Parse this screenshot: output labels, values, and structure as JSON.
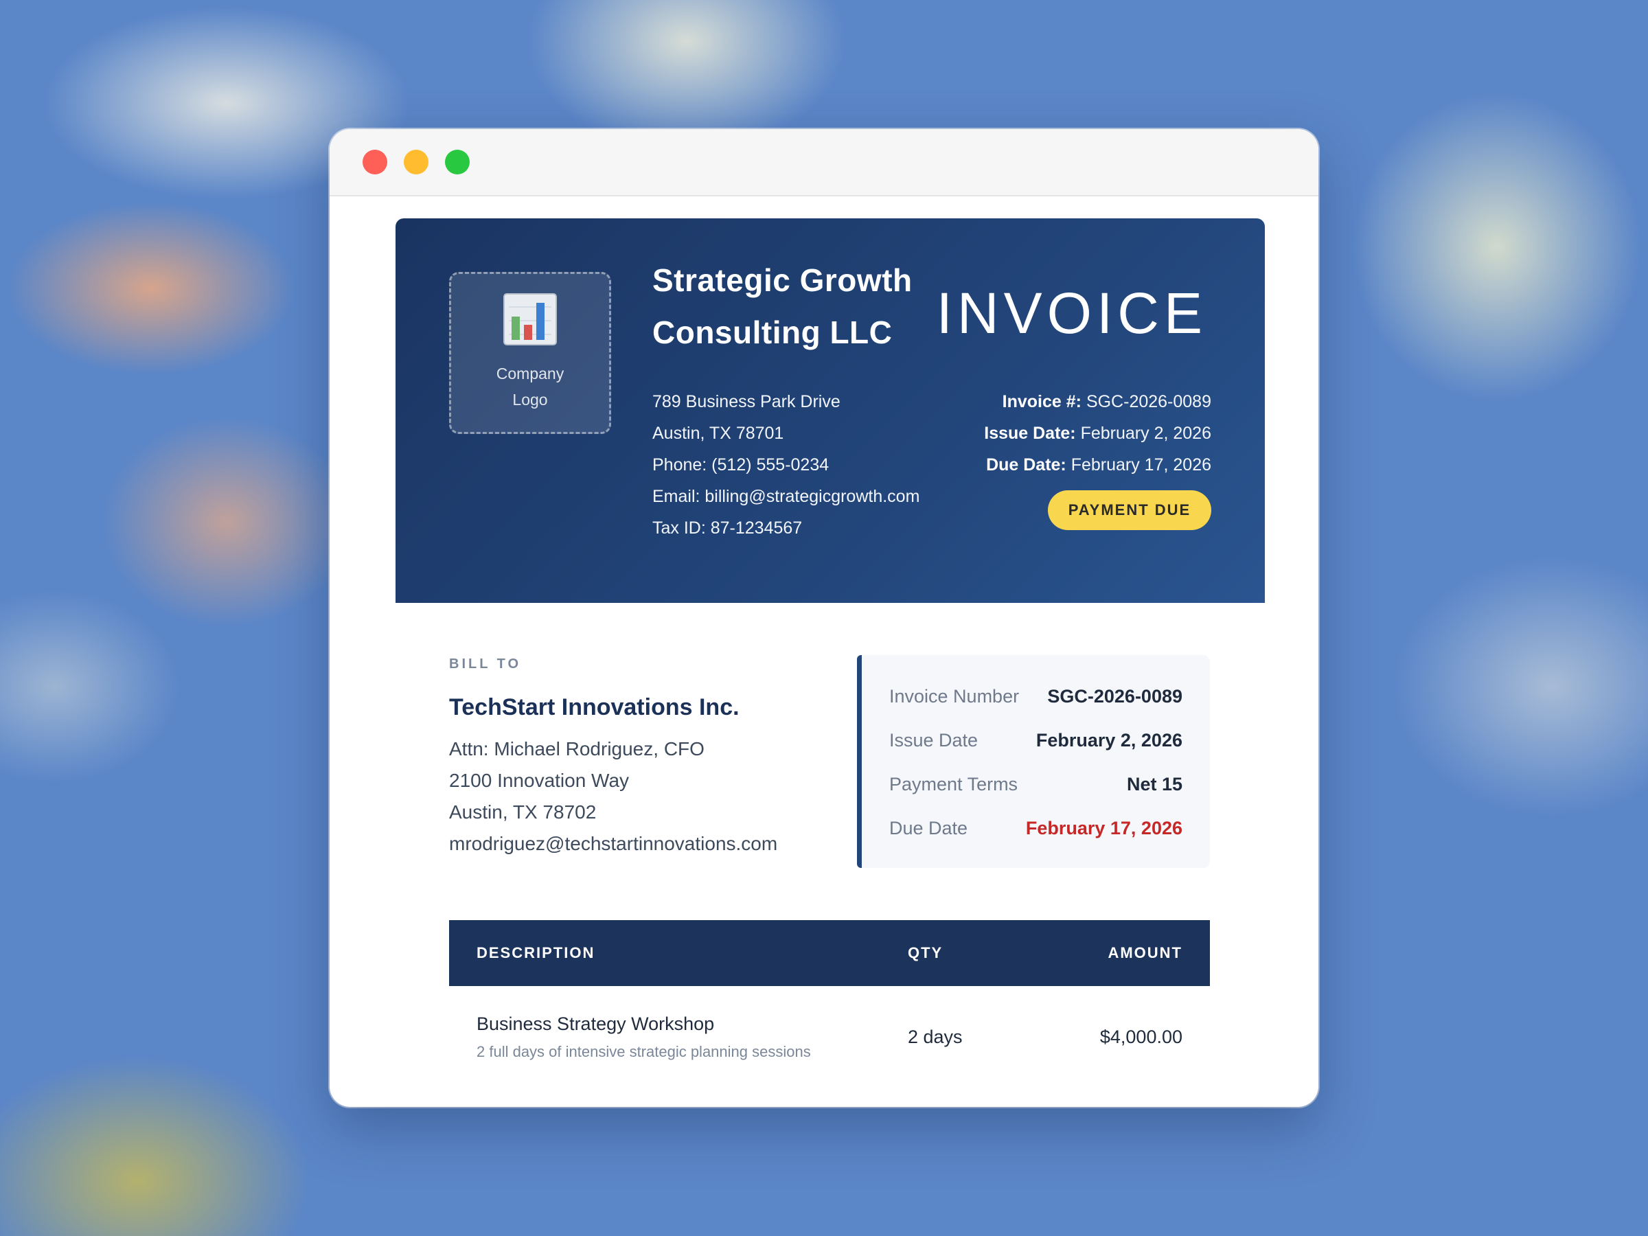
{
  "window": {
    "controls": {
      "close_color": "#fe5f57",
      "minimize_color": "#febc2e",
      "maximize_color": "#28c840"
    }
  },
  "company": {
    "logo_icon": "bar-chart-icon",
    "logo_label": "Company Logo",
    "name": "Strategic Growth Consulting LLC",
    "address_line1": "789 Business Park Drive",
    "address_line2": "Austin, TX 78701",
    "phone": "Phone: (512) 555-0234",
    "email": "Email: billing@strategicgrowth.com",
    "tax_id": "Tax ID: 87-1234567"
  },
  "invoice": {
    "title": "INVOICE",
    "number_label": "Invoice #:",
    "number": "SGC-2026-0089",
    "issue_label": "Issue Date:",
    "issue_date": "February 2, 2026",
    "due_label": "Due Date:",
    "due_date": "February 17, 2026",
    "status_badge": "PAYMENT DUE"
  },
  "bill_to": {
    "label": "BILL TO",
    "name": "TechStart Innovations Inc.",
    "attn": "Attn: Michael Rodriguez, CFO",
    "address_line1": "2100 Innovation Way",
    "address_line2": "Austin, TX 78702",
    "email": "mrodriguez@techstartinnovations.com"
  },
  "summary": [
    {
      "label": "Invoice Number",
      "value": "SGC-2026-0089"
    },
    {
      "label": "Issue Date",
      "value": "February 2, 2026"
    },
    {
      "label": "Payment Terms",
      "value": "Net 15"
    },
    {
      "label": "Due Date",
      "value": "February 17, 2026"
    }
  ],
  "items": {
    "headers": {
      "description": "DESCRIPTION",
      "qty": "QTY",
      "amount": "AMOUNT"
    },
    "rows": [
      {
        "title": "Business Strategy Workshop",
        "subtitle": "2 full days of intensive strategic planning sessions",
        "qty": "2 days",
        "amount": "$4,000.00"
      }
    ]
  },
  "colors": {
    "brand_navy": "#1c335c",
    "badge_yellow": "#f8d64e",
    "due_red": "#c62828"
  }
}
